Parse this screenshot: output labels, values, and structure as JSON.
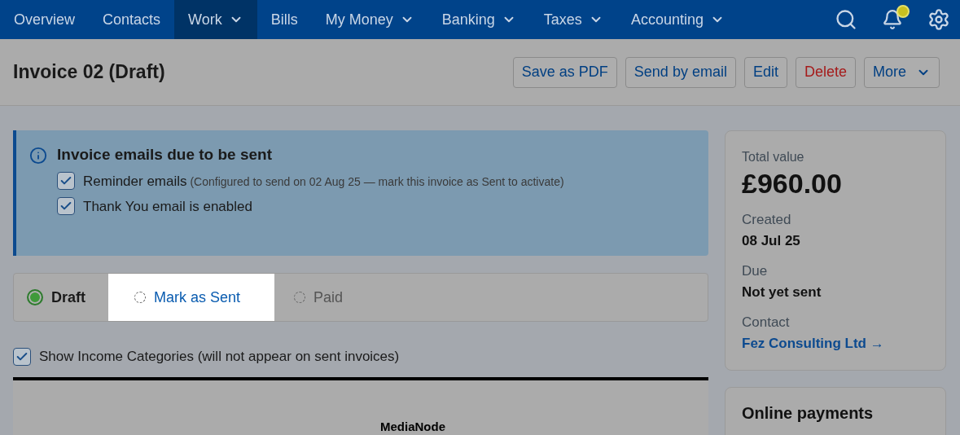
{
  "nav": {
    "items": [
      {
        "label": "Overview",
        "selected": false,
        "dropdown": false
      },
      {
        "label": "Contacts",
        "selected": false,
        "dropdown": false
      },
      {
        "label": "Work",
        "selected": true,
        "dropdown": true
      },
      {
        "label": "Bills",
        "selected": false,
        "dropdown": false
      },
      {
        "label": "My Money",
        "selected": false,
        "dropdown": true
      },
      {
        "label": "Banking",
        "selected": false,
        "dropdown": true
      },
      {
        "label": "Taxes",
        "selected": false,
        "dropdown": true
      },
      {
        "label": "Accounting",
        "selected": false,
        "dropdown": true
      }
    ],
    "notification_alert": true
  },
  "header": {
    "title": "Invoice 02 (Draft)",
    "actions": [
      {
        "label": "Save as PDF",
        "kind": "normal",
        "dropdown": false
      },
      {
        "label": "Send by email",
        "kind": "normal",
        "dropdown": false
      },
      {
        "label": "Edit",
        "kind": "normal",
        "dropdown": false
      },
      {
        "label": "Delete",
        "kind": "danger",
        "dropdown": false
      },
      {
        "label": "More",
        "kind": "normal",
        "dropdown": true
      }
    ]
  },
  "notice": {
    "title": "Invoice emails due to be sent",
    "options": [
      {
        "label": "Reminder emails",
        "note": "(Configured to send on 02 Aug 25 — mark this invoice as Sent to activate)",
        "checked": true
      },
      {
        "label": "Thank You email is enabled",
        "checked": true
      }
    ]
  },
  "stepper": [
    {
      "label": "Draft",
      "done": true,
      "highlighted": false
    },
    {
      "label": "Mark as Sent",
      "done": false,
      "highlighted": true
    },
    {
      "label": "Paid",
      "done": false,
      "highlighted": false
    }
  ],
  "show_categories": {
    "label": "Show Income Categories (will not appear on sent invoices)",
    "checked": true
  },
  "invoice_preview": {
    "company": "MediaNode"
  },
  "summary": {
    "total_label": "Total value",
    "total": "£960.00",
    "fields": [
      {
        "label": "Created",
        "value": "08 Jul 25",
        "kind": "text"
      },
      {
        "label": "Due",
        "value": "Not yet sent",
        "kind": "text"
      },
      {
        "label": "Contact",
        "value": "Fez Consulting Ltd →",
        "kind": "link"
      }
    ]
  },
  "online_payments": {
    "title": "Online payments"
  }
}
